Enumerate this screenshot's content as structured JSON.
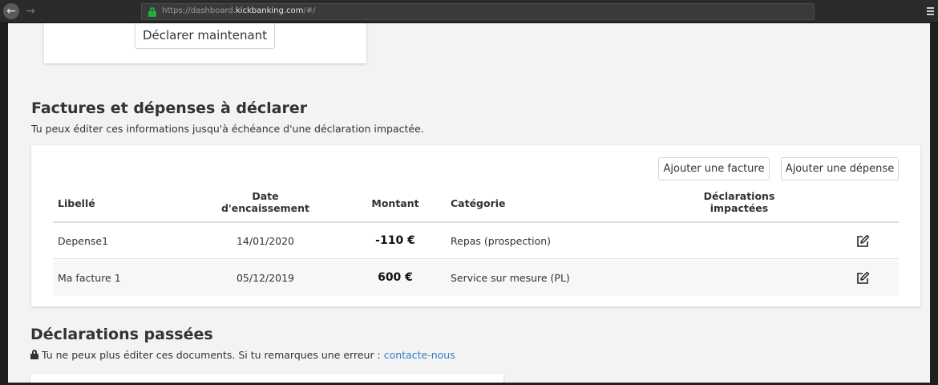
{
  "browser": {
    "url_prefix": "https://dashboard.",
    "url_host": "kickbanking.com",
    "url_suffix": "/#/",
    "back_icon": "arrow-left-icon",
    "forward_icon": "arrow-right-icon",
    "lock_color": "#1fae37"
  },
  "top_card": {
    "declare_button": "Déclarer maintenant"
  },
  "factures": {
    "title": "Factures et dépenses à déclarer",
    "subtitle": "Tu peux éditer ces informations jusqu'à échéance d'une déclaration impactée.",
    "add_facture": "Ajouter une facture",
    "add_depense": "Ajouter une dépense",
    "columns": {
      "libelle": "Libellé",
      "date_line1": "Date",
      "date_line2": "d'encaissement",
      "montant": "Montant",
      "categorie": "Catégorie",
      "decl_line1": "Déclarations",
      "decl_line2": "impactées"
    },
    "rows": [
      {
        "libelle": "Depense1",
        "date": "14/01/2020",
        "montant": "-110 €",
        "categorie": "Repas (prospection)",
        "declarations": ""
      },
      {
        "libelle": "Ma facture 1",
        "date": "05/12/2019",
        "montant": "600 €",
        "categorie": "Service sur mesure (PL)",
        "declarations": ""
      }
    ]
  },
  "passees": {
    "title": "Déclarations passées",
    "notice": "Tu ne peux plus éditer ces documents. Si tu remarques une erreur : ",
    "contact_link": "contacte-nous"
  },
  "colors": {
    "link": "#2f7fc2",
    "page_bg": "#f3f3f3"
  }
}
